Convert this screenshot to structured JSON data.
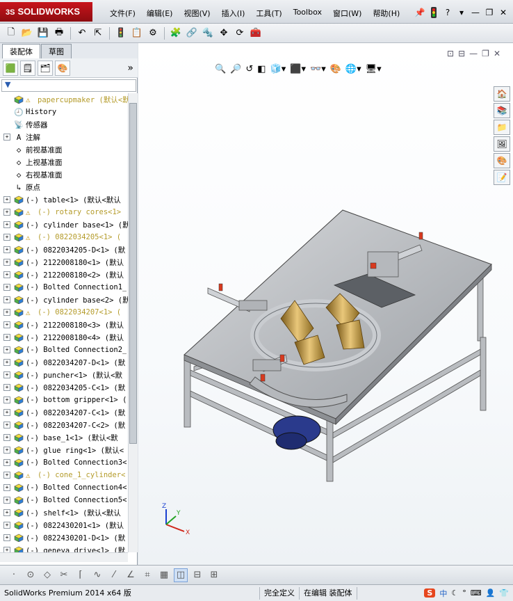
{
  "app": {
    "brand": "SOLIDWORKS",
    "brand_prefix": "3S"
  },
  "menus": [
    "文件(F)",
    "编辑(E)",
    "视图(V)",
    "插入(I)",
    "工具(T)",
    "Toolbox",
    "窗口(W)",
    "帮助(H)"
  ],
  "title_icons": [
    "pushpin-icon",
    "traffic-light-icon",
    "help-icon",
    "minimize-icon",
    "restore-icon",
    "close-icon"
  ],
  "tabs": [
    {
      "label": "装配体"
    },
    {
      "label": "草图"
    }
  ],
  "tree": {
    "root": "papercupmaker  (默认<默认",
    "items": [
      {
        "label": "History",
        "icon": "history-icon",
        "expand": false,
        "warn": false
      },
      {
        "label": "传感器",
        "icon": "sensor-icon",
        "expand": false,
        "warn": false
      },
      {
        "label": "注解",
        "icon": "annotation-icon",
        "expand": true,
        "warn": false
      },
      {
        "label": "前视基准面",
        "icon": "plane-icon",
        "expand": false,
        "warn": false
      },
      {
        "label": "上视基准面",
        "icon": "plane-icon",
        "expand": false,
        "warn": false
      },
      {
        "label": "右视基准面",
        "icon": "plane-icon",
        "expand": false,
        "warn": false
      },
      {
        "label": "原点",
        "icon": "origin-icon",
        "expand": false,
        "warn": false
      },
      {
        "label": "(-) table<1> (默认<默认",
        "icon": "part-icon",
        "expand": true,
        "warn": false
      },
      {
        "label": "(-) rotary cores<1>",
        "icon": "part-icon",
        "expand": true,
        "warn": true
      },
      {
        "label": "(-) cylinder base<1> (默",
        "icon": "part-icon",
        "expand": true,
        "warn": false
      },
      {
        "label": "(-) 0822034205<1> (",
        "icon": "part-icon",
        "expand": true,
        "warn": true
      },
      {
        "label": "(-) 0822034205-D<1> (默",
        "icon": "part-icon",
        "expand": true,
        "warn": false
      },
      {
        "label": "(-) 2122008180<1> (默认",
        "icon": "part-icon",
        "expand": true,
        "warn": false
      },
      {
        "label": "(-) 2122008180<2> (默认",
        "icon": "part-icon",
        "expand": true,
        "warn": false
      },
      {
        "label": "(-) Bolted Connection1_",
        "icon": "part-icon",
        "expand": true,
        "warn": false
      },
      {
        "label": "(-) cylinder base<2> (默",
        "icon": "part-icon",
        "expand": true,
        "warn": false
      },
      {
        "label": "(-) 0822034207<1> (",
        "icon": "part-icon",
        "expand": true,
        "warn": true
      },
      {
        "label": "(-) 2122008180<3> (默认",
        "icon": "part-icon",
        "expand": true,
        "warn": false
      },
      {
        "label": "(-) 2122008180<4> (默认",
        "icon": "part-icon",
        "expand": true,
        "warn": false
      },
      {
        "label": "(-) Bolted Connection2_",
        "icon": "part-icon",
        "expand": true,
        "warn": false
      },
      {
        "label": "(-) 0822034207-D<1> (默",
        "icon": "part-icon",
        "expand": true,
        "warn": false
      },
      {
        "label": "(-) puncher<1> (默认<默",
        "icon": "part-icon",
        "expand": true,
        "warn": false
      },
      {
        "label": "(-) 0822034205-C<1> (默",
        "icon": "part-icon",
        "expand": true,
        "warn": false
      },
      {
        "label": "(-) bottom gripper<1> (",
        "icon": "part-icon",
        "expand": true,
        "warn": false
      },
      {
        "label": "(-) 0822034207-C<1> (默",
        "icon": "part-icon",
        "expand": true,
        "warn": false
      },
      {
        "label": "(-) 0822034207-C<2> (默",
        "icon": "part-icon",
        "expand": true,
        "warn": false
      },
      {
        "label": "(-) base_1<1> (默认<默",
        "icon": "part-icon",
        "expand": true,
        "warn": false
      },
      {
        "label": "(-) glue ring<1> (默认<",
        "icon": "part-icon",
        "expand": true,
        "warn": false
      },
      {
        "label": "(-) Bolted Connection3<",
        "icon": "part-icon",
        "expand": true,
        "warn": false
      },
      {
        "label": "(-) cone_1_cylinder<",
        "icon": "part-icon",
        "expand": true,
        "warn": true
      },
      {
        "label": "(-) Bolted Connection4<",
        "icon": "part-icon",
        "expand": true,
        "warn": false
      },
      {
        "label": "(-) Bolted Connection5<",
        "icon": "part-icon",
        "expand": true,
        "warn": false
      },
      {
        "label": "(-) shelf<1> (默认<默认",
        "icon": "part-icon",
        "expand": true,
        "warn": false
      },
      {
        "label": "(-) 0822430201<1> (默认",
        "icon": "part-icon",
        "expand": true,
        "warn": false
      },
      {
        "label": "(-) 0822430201-D<1> (默",
        "icon": "part-icon",
        "expand": true,
        "warn": false
      },
      {
        "label": "(-) geneva drive<1> (默",
        "icon": "part-icon",
        "expand": true,
        "warn": false
      }
    ]
  },
  "triad": {
    "x": "X",
    "y": "Y",
    "z": "Z"
  },
  "status": {
    "app": "SolidWorks Premium 2014 x64 版",
    "definition": "完全定义",
    "mode": "在编辑 装配体"
  },
  "ime": {
    "logo": "S",
    "lang": "中"
  }
}
